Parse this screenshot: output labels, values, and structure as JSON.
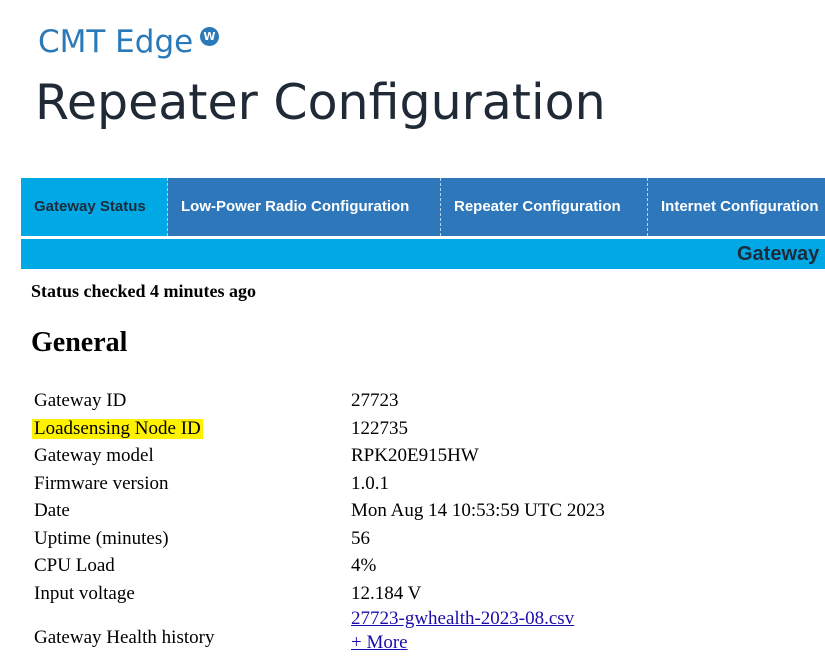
{
  "header": {
    "brand": "CMT Edge",
    "brand_badge": "W",
    "page_title": "Repeater Configuration"
  },
  "nav": {
    "tabs": [
      {
        "label": "Gateway Status",
        "active": true
      },
      {
        "label": "Low-Power Radio Configuration",
        "active": false
      },
      {
        "label": "Repeater Configuration",
        "active": false
      },
      {
        "label": "Internet Configuration",
        "active": false
      }
    ]
  },
  "subbar": {
    "title": "Gateway"
  },
  "status": {
    "checked": "Status checked 4 minutes ago"
  },
  "general": {
    "heading": "General",
    "rows": [
      {
        "label": "Gateway ID",
        "value": "27723"
      },
      {
        "label": "Loadsensing Node ID",
        "value": "122735"
      },
      {
        "label": "Gateway model",
        "value": "RPK20E915HW"
      },
      {
        "label": "Firmware version",
        "value": "1.0.1"
      },
      {
        "label": "Date",
        "value": "Mon Aug 14 10:53:59 UTC 2023"
      },
      {
        "label": "Uptime (minutes)",
        "value": "56"
      },
      {
        "label": "CPU Load",
        "value": "4%"
      },
      {
        "label": "Input voltage",
        "value": "12.184 V"
      }
    ],
    "health": {
      "label": "Gateway Health history",
      "file_link": "27723-gwhealth-2023-08.csv",
      "more_link": "+ More"
    }
  },
  "colors": {
    "brand": "#2a79b9",
    "nav_bg": "#2d77ba",
    "nav_active": "#00a8e5",
    "highlight": "#fff200",
    "link": "#1a0dab"
  }
}
